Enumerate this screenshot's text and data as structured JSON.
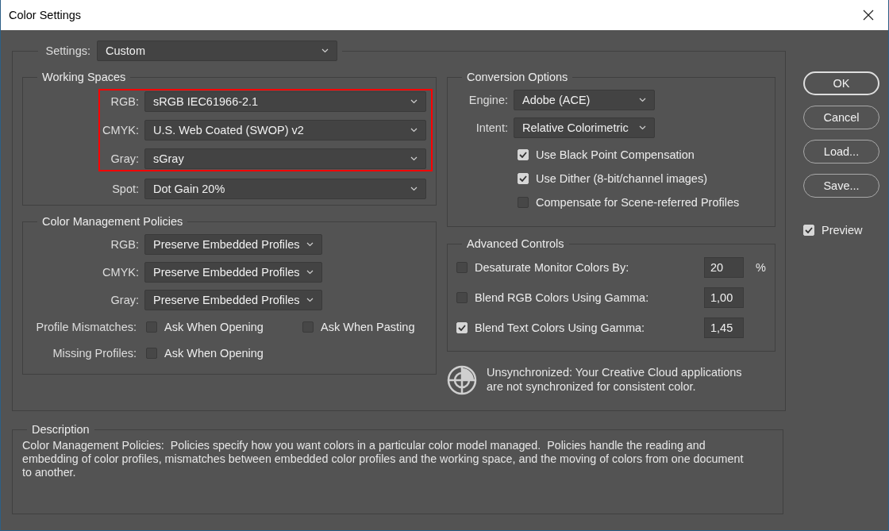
{
  "window": {
    "title": "Color Settings"
  },
  "settings": {
    "label": "Settings:",
    "value": "Custom"
  },
  "working_spaces": {
    "title": "Working Spaces",
    "rows": [
      {
        "label": "RGB:",
        "value": "sRGB IEC61966-2.1",
        "highlighted": true
      },
      {
        "label": "CMYK:",
        "value": "U.S. Web Coated (SWOP) v2",
        "highlighted": true
      },
      {
        "label": "Gray:",
        "value": "sGray",
        "highlighted": true
      },
      {
        "label": "Spot:",
        "value": "Dot Gain 20%",
        "highlighted": false
      }
    ]
  },
  "color_management_policies": {
    "title": "Color Management Policies",
    "policies": [
      {
        "label": "RGB:",
        "value": "Preserve Embedded Profiles"
      },
      {
        "label": "CMYK:",
        "value": "Preserve Embedded Profiles"
      },
      {
        "label": "Gray:",
        "value": "Preserve Embedded Profiles"
      }
    ],
    "options": [
      {
        "label": "Profile Mismatches:",
        "checks": [
          {
            "label": "Ask When Opening",
            "checked": false
          },
          {
            "label": "Ask When Pasting",
            "checked": false
          }
        ]
      },
      {
        "label": "Missing Profiles:",
        "checks": [
          {
            "label": "Ask When Opening",
            "checked": false
          }
        ]
      }
    ]
  },
  "conversion_options": {
    "title": "Conversion Options",
    "selects": [
      {
        "label": "Engine:",
        "value": "Adobe (ACE)"
      },
      {
        "label": "Intent:",
        "value": "Relative Colorimetric"
      }
    ],
    "checks": [
      {
        "label": "Use Black Point Compensation",
        "checked": true
      },
      {
        "label": "Use Dither (8-bit/channel images)",
        "checked": true
      },
      {
        "label": "Compensate for Scene-referred Profiles",
        "checked": false
      }
    ]
  },
  "advanced_controls": {
    "title": "Advanced Controls",
    "rows": [
      {
        "label": "Desaturate Monitor Colors By:",
        "checked": false,
        "value": "20",
        "unit": "%"
      },
      {
        "label": "Blend RGB Colors Using Gamma:",
        "checked": false,
        "value": "1,00"
      },
      {
        "label": "Blend Text Colors Using Gamma:",
        "checked": true,
        "value": "1,45"
      }
    ]
  },
  "sync_message": "Unsynchronized: Your Creative Cloud applications are not synchronized for consistent color.",
  "buttons": [
    {
      "label": "OK",
      "default": true
    },
    {
      "label": "Cancel",
      "default": false
    },
    {
      "label": "Load...",
      "default": false
    },
    {
      "label": "Save...",
      "default": false
    }
  ],
  "preview": {
    "label": "Preview",
    "checked": true
  },
  "description": {
    "title": "Description",
    "text": "Color Management Policies:  Policies specify how you want colors in a particular color model managed.  Policies handle the reading and embedding of color profiles, mismatches between embedded color profiles and the working space, and the moving of colors from one document to another."
  }
}
